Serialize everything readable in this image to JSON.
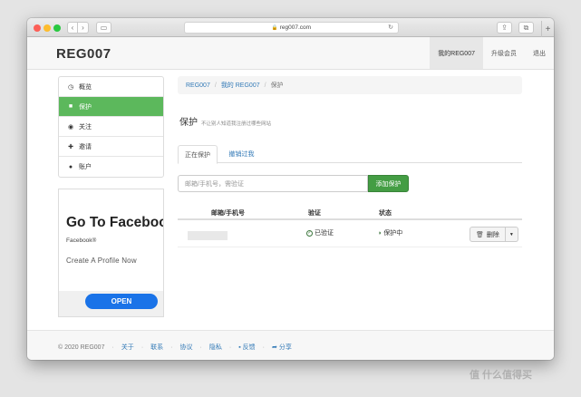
{
  "browser": {
    "url": "reg007.com",
    "new_tab": "+"
  },
  "site": {
    "logo": "REG007",
    "nav": [
      {
        "label": "我的REG007",
        "active": true
      },
      {
        "label": "升级会员",
        "active": false
      },
      {
        "label": "退出",
        "active": false
      }
    ]
  },
  "sidebar": {
    "items": [
      {
        "label": "概览",
        "icon": "clock-icon",
        "active": false
      },
      {
        "label": "保护",
        "icon": "lock-icon",
        "active": true
      },
      {
        "label": "关注",
        "icon": "eye-icon",
        "active": false
      },
      {
        "label": "邀请",
        "icon": "gift-icon",
        "active": false
      },
      {
        "label": "账户",
        "icon": "user-icon",
        "active": false
      }
    ]
  },
  "ad": {
    "title": "Go To Facebook",
    "subtitle": "Facebook®",
    "cta": "Create A Profile Now",
    "button": "OPEN"
  },
  "breadcrumb": {
    "items": [
      "REG007",
      "我的 REG007",
      "保护"
    ]
  },
  "page": {
    "title": "保护",
    "subtitle": "不让别人知道我注册过哪些网站"
  },
  "tabs": [
    {
      "label": "正在保护",
      "active": true
    },
    {
      "label": "撤销过我",
      "active": false
    }
  ],
  "add_form": {
    "placeholder": "邮箱/手机号，需验证",
    "button": "添加保护"
  },
  "table": {
    "headers": [
      "邮箱/手机号",
      "验证",
      "状态"
    ],
    "rows": [
      {
        "account": "",
        "verified": "已验证",
        "status": "保护中",
        "action": "删除"
      }
    ]
  },
  "footer": {
    "copyright": "© 2020 REG007",
    "links": [
      "关于",
      "联系",
      "协议",
      "隐私",
      "反馈",
      "分享"
    ]
  },
  "watermark": "值 什么值得买"
}
